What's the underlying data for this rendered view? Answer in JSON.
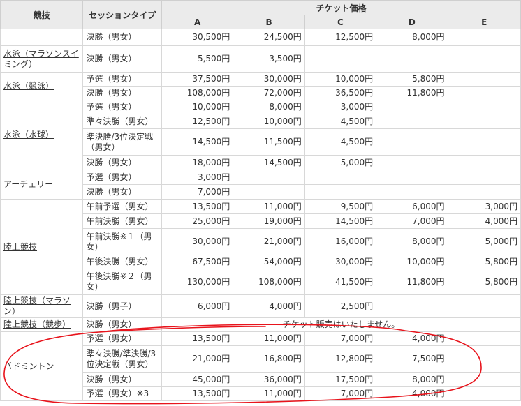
{
  "header": {
    "sport": "競技",
    "session_type": "セッションタイプ",
    "price_group": "チケット価格",
    "cat_a": "A",
    "cat_b": "B",
    "cat_c": "C",
    "cat_d": "D",
    "cat_e": "E"
  },
  "rows": [
    {
      "session": "決勝（男女）",
      "a": "30,500円",
      "b": "24,500円",
      "c": "12,500円",
      "d": "8,000円",
      "e": ""
    },
    {
      "session": "決勝（男女）",
      "a": "5,500円",
      "b": "3,500円",
      "c": "",
      "d": "",
      "e": ""
    },
    {
      "session": "予選（男女）",
      "a": "37,500円",
      "b": "30,000円",
      "c": "10,000円",
      "d": "5,800円",
      "e": ""
    },
    {
      "session": "決勝（男女）",
      "a": "108,000円",
      "b": "72,000円",
      "c": "36,500円",
      "d": "11,800円",
      "e": ""
    },
    {
      "session": "予選（男女）",
      "a": "10,000円",
      "b": "8,000円",
      "c": "3,000円",
      "d": "",
      "e": ""
    },
    {
      "session": "準々決勝（男女）",
      "a": "12,500円",
      "b": "10,000円",
      "c": "4,500円",
      "d": "",
      "e": ""
    },
    {
      "session": "準決勝/3位決定戦（男女）",
      "a": "14,500円",
      "b": "11,500円",
      "c": "4,500円",
      "d": "",
      "e": ""
    },
    {
      "session": "決勝（男女）",
      "a": "18,000円",
      "b": "14,500円",
      "c": "5,000円",
      "d": "",
      "e": ""
    },
    {
      "session": "予選（男女）",
      "a": "3,000円",
      "b": "",
      "c": "",
      "d": "",
      "e": ""
    },
    {
      "session": "決勝（男女）",
      "a": "7,000円",
      "b": "",
      "c": "",
      "d": "",
      "e": ""
    },
    {
      "session": "午前予選（男女）",
      "a": "13,500円",
      "b": "11,000円",
      "c": "9,500円",
      "d": "6,000円",
      "e": "3,000円"
    },
    {
      "session": "午前決勝（男女）",
      "a": "25,000円",
      "b": "19,000円",
      "c": "14,500円",
      "d": "7,000円",
      "e": "4,000円"
    },
    {
      "session": "午前決勝※１（男女）",
      "a": "30,000円",
      "b": "21,000円",
      "c": "16,000円",
      "d": "8,000円",
      "e": "5,000円"
    },
    {
      "session": "午後決勝（男女）",
      "a": "67,500円",
      "b": "54,000円",
      "c": "30,000円",
      "d": "10,000円",
      "e": "5,800円"
    },
    {
      "session": "午後決勝※２（男女）",
      "a": "130,000円",
      "b": "108,000円",
      "c": "41,500円",
      "d": "11,800円",
      "e": "5,800円"
    },
    {
      "session": "決勝（男子）",
      "a": "6,000円",
      "b": "4,000円",
      "c": "2,500円",
      "d": "",
      "e": ""
    },
    {
      "session": "決勝（男女）",
      "notice": "チケット販売はいたしません。"
    },
    {
      "session": "予選（男女）",
      "a": "13,500円",
      "b": "11,000円",
      "c": "7,000円",
      "d": "4,000円",
      "e": ""
    },
    {
      "session": "準々決勝/準決勝/3位決定戦（男女）",
      "a": "21,000円",
      "b": "16,800円",
      "c": "12,800円",
      "d": "7,500円",
      "e": ""
    },
    {
      "session": "決勝（男女）",
      "a": "45,000円",
      "b": "36,000円",
      "c": "17,500円",
      "d": "8,000円",
      "e": ""
    },
    {
      "session": "予選（男女）※3",
      "a": "13,500円",
      "b": "11,000円",
      "c": "7,000円",
      "d": "4,000円",
      "e": ""
    }
  ],
  "sports": {
    "marathon_swim": "水泳（マラソンスイミング）",
    "swimming": "水泳（競泳）",
    "water_polo": "水泳（水球）",
    "archery": "アーチェリー",
    "athletics": "陸上競技",
    "athletics_marathon": "陸上競技（マラソン）",
    "athletics_walk": "陸上競技（競歩）",
    "badminton": "バドミントン"
  },
  "annotation": {
    "color": "#e8141c"
  }
}
